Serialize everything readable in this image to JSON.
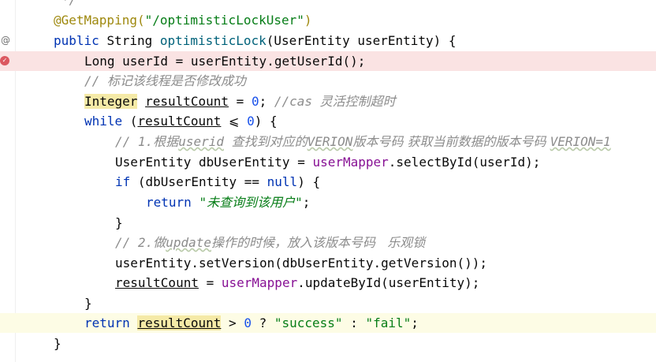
{
  "gutter": {
    "method_icon": "at-sign-icon",
    "breakpoint_icon": "breakpoint-icon"
  },
  "code": {
    "l0": {
      "t1": "*/"
    },
    "l1": {
      "t1": "@GetMapping(",
      "t2": "\"/optimisticLockUser\"",
      "t3": ")"
    },
    "l2": {
      "t1": "public ",
      "t2": "String ",
      "t3": "optimisticLock",
      "t4": "(UserEntity userEntity) {"
    },
    "l3": {
      "t1": "Long userId = userEntity.getUserId();"
    },
    "l4": {
      "t1": "// ",
      "t2": "标记该线程是否修改成功"
    },
    "l5": {
      "t1": "Integer",
      "t2": " ",
      "t3": "resultCount",
      "t4": " = ",
      "t5": "0",
      "t6": "; ",
      "t7": "//cas ",
      "t8": "灵活控制超时"
    },
    "l6": {
      "t1": "while",
      "t2": " (",
      "t3": "resultCount",
      "t4": " ⩽ ",
      "t5": "0",
      "t6": ") {"
    },
    "l7": {
      "t1": "// 1.",
      "t2": "根据",
      "t3": "userid",
      "t4": " ",
      "t5": "查找到对应的",
      "t6": "VERION",
      "t7": "版本号码 获取当前数据的版本号码 ",
      "t8": "VERION=1"
    },
    "l8": {
      "t1": "UserEntity dbUserEntity = ",
      "t2": "userMapper",
      "t3": ".selectById(userId);"
    },
    "l9": {
      "t1": "if",
      "t2": " (dbUserEntity == ",
      "t3": "null",
      "t4": ") {"
    },
    "l10": {
      "t1": "return ",
      "t2": "\"",
      "t3": "未查询到该用户",
      "t4": "\"",
      "t5": ";"
    },
    "l11": {
      "t1": "}"
    },
    "l12": {
      "t1": "// 2.",
      "t2": "做",
      "t3": "update",
      "t4": "操作的时候，放入该版本号码   乐观锁"
    },
    "l13": {
      "t1": "userEntity.setVersion(dbUserEntity.getVersion());"
    },
    "l14": {
      "t1": "resultCount",
      "t2": " = ",
      "t3": "userMapper",
      "t4": ".updateById(userEntity);"
    },
    "l15": {
      "t1": "}"
    },
    "l16": {
      "t1": "return ",
      "t2": "resultCount",
      "t3": " > ",
      "t4": "0",
      "t5": " ? ",
      "t6": "\"success\"",
      "t7": " : ",
      "t8": "\"fail\"",
      "t9": ";"
    },
    "l17": {
      "t1": "}"
    }
  }
}
